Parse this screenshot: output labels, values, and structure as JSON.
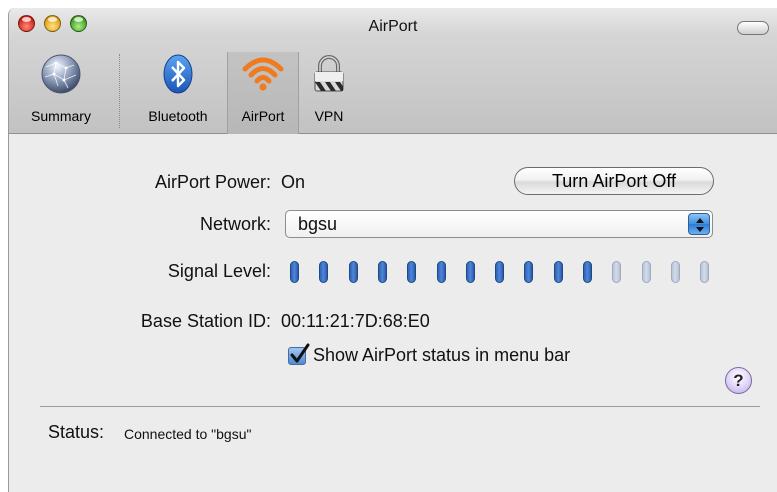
{
  "window": {
    "title": "AirPort"
  },
  "toolbar": {
    "items": [
      {
        "label": "Summary",
        "icon": "globe-icon"
      },
      {
        "label": "Bluetooth",
        "icon": "bluetooth-icon"
      },
      {
        "label": "AirPort",
        "icon": "wifi-icon",
        "selected": true
      },
      {
        "label": "VPN",
        "icon": "lock-icon"
      }
    ]
  },
  "airport_power": {
    "label": "AirPort Power:",
    "value": "On",
    "button_label": "Turn AirPort Off"
  },
  "network": {
    "label": "Network:",
    "selected": "bgsu"
  },
  "signal": {
    "label": "Signal Level:",
    "total_bars": 15,
    "active_bars": 11
  },
  "base_station": {
    "label": "Base Station ID:",
    "value": "00:11:21:7D:68:E0"
  },
  "menu_bar_checkbox": {
    "label": "Show AirPort status in menu bar",
    "checked": true
  },
  "help": {
    "label": "?"
  },
  "status": {
    "label": "Status:",
    "value": "Connected to \"bgsu\""
  },
  "colors": {
    "accent": "#3f8fe0",
    "signal_on": "#3a6fc4",
    "signal_off": "#c6d0e0",
    "airport_orange": "#f07a1e"
  }
}
